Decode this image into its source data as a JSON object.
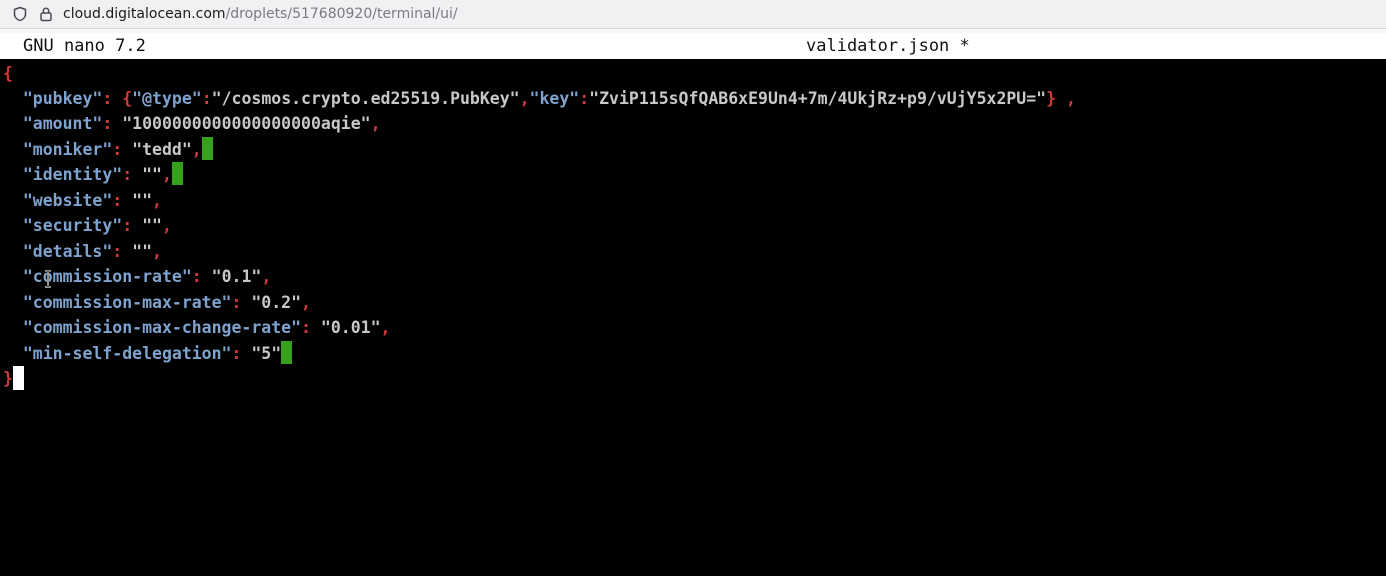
{
  "browser": {
    "url_host": "cloud.digitalocean.com",
    "url_path": "/droplets/517680920/terminal/ui/"
  },
  "nano": {
    "version_label": "GNU nano 7.2",
    "filename": "validator.json *"
  },
  "file": {
    "open_brace": "{",
    "close_brace": "}",
    "pubkey_key": "\"pubkey\"",
    "pubkey_type_key": "\"@type\"",
    "pubkey_type_value": "\"/cosmos.crypto.ed25519.PubKey\"",
    "pubkey_key_key": "\"key\"",
    "pubkey_key_value": "\"ZviP115sQfQAB6xE9Un4+7m/4UkjRz+p9/vUjY5x2PU=\"",
    "amount_key": "\"amount\"",
    "amount_value": "\"1000000000000000000aqie\"",
    "moniker_key": "\"moniker\"",
    "moniker_value": "\"tedd\"",
    "identity_key": "\"identity\"",
    "identity_value": "\"\"",
    "website_key": "\"website\"",
    "website_value": "\"\"",
    "security_key": "\"security\"",
    "security_value": "\"\"",
    "details_key": "\"details\"",
    "details_value": "\"\"",
    "commission_rate_key": "\"commission-rate\"",
    "commission_rate_value": "\"0.1\"",
    "commission_max_rate_key": "\"commission-max-rate\"",
    "commission_max_rate_value": "\"0.2\"",
    "commission_max_change_rate_key": "\"commission-max-change-rate\"",
    "commission_max_change_rate_value": "\"0.01\"",
    "min_self_delegation_key": "\"min-self-delegation\"",
    "min_self_delegation_value": "\"5\""
  },
  "icons": {
    "shield": "shield-icon",
    "lock": "lock-icon"
  },
  "colors": {
    "key": "#7fa3cf",
    "string": "#c8c8c8",
    "punct": "#d23a3a",
    "highlight": "#36a11d",
    "cursor": "#ffffff"
  }
}
